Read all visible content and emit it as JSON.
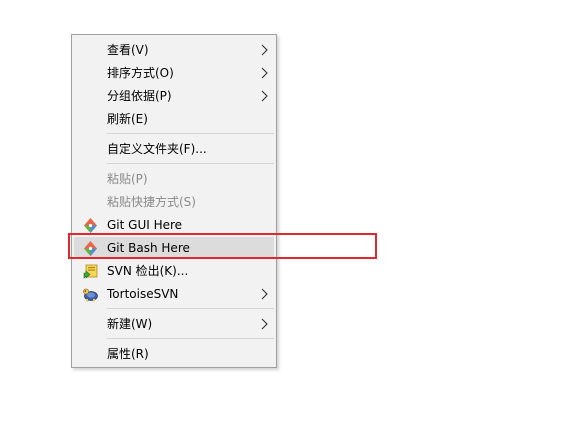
{
  "menu": {
    "items": [
      {
        "label": "查看(V)",
        "submenu": true,
        "enabled": true
      },
      {
        "label": "排序方式(O)",
        "submenu": true,
        "enabled": true
      },
      {
        "label": "分组依据(P)",
        "submenu": true,
        "enabled": true
      },
      {
        "label": "刷新(E)",
        "submenu": false,
        "enabled": true
      },
      {
        "label": "自定义文件夹(F)...",
        "submenu": false,
        "enabled": true
      },
      {
        "label": "粘贴(P)",
        "submenu": false,
        "enabled": false
      },
      {
        "label": "粘贴快捷方式(S)",
        "submenu": false,
        "enabled": false
      },
      {
        "label": "Git GUI Here",
        "submenu": false,
        "enabled": true,
        "icon": "git-icon"
      },
      {
        "label": "Git Bash Here",
        "submenu": false,
        "enabled": true,
        "icon": "git-icon",
        "highlighted": true
      },
      {
        "label": "SVN 检出(K)...",
        "submenu": false,
        "enabled": true,
        "icon": "svn-checkout-icon"
      },
      {
        "label": "TortoiseSVN",
        "submenu": true,
        "enabled": true,
        "icon": "tortoisesvn-icon"
      },
      {
        "label": "新建(W)",
        "submenu": true,
        "enabled": true
      },
      {
        "label": "属性(R)",
        "submenu": false,
        "enabled": true
      }
    ]
  },
  "colors": {
    "menu_background": "#f2f2f2",
    "highlight": "#dcdcdc",
    "disabled_text": "#8a8a8a",
    "annotation_box": "#e0282e"
  }
}
